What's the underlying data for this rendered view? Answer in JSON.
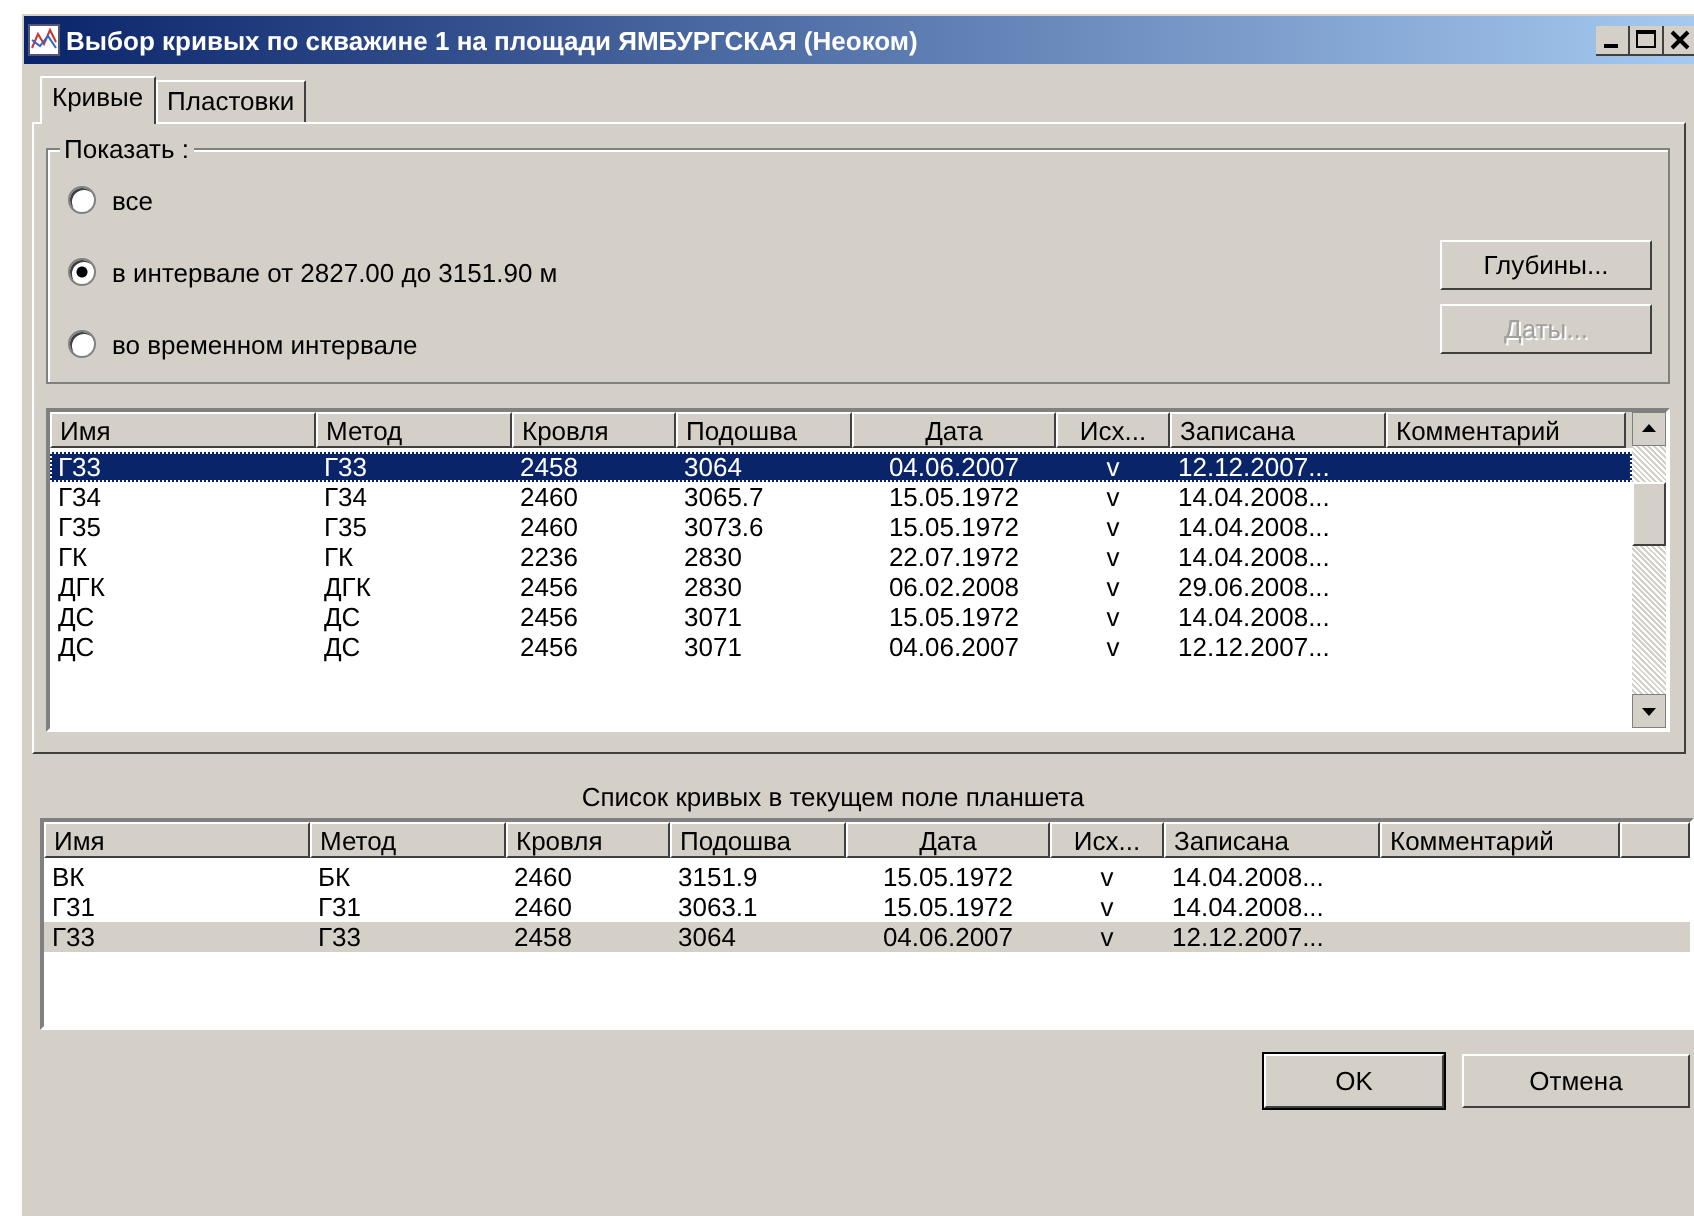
{
  "window": {
    "title": "Выбор кривых по скважине 1 на площади ЯМБУРГСКАЯ (Неоком)"
  },
  "tabs": [
    {
      "label": "Кривые",
      "selected": true
    },
    {
      "label": "Пластовки",
      "selected": false
    }
  ],
  "show_group": {
    "title": "Показать :",
    "options": [
      {
        "label": "все",
        "selected": false
      },
      {
        "label": "в интервале от 2827.00 до 3151.90 м",
        "selected": true
      },
      {
        "label": "во временном интервале",
        "selected": false
      }
    ],
    "buttons": [
      {
        "label": "Глубины...",
        "disabled": false
      },
      {
        "label": "Даты...",
        "disabled": true
      }
    ]
  },
  "curves_table": {
    "columns": [
      "Имя",
      "Метод",
      "Кровля",
      "Подошва",
      "Дата",
      "Исх...",
      "Записана",
      "Комментарий"
    ],
    "rows": [
      {
        "cells": [
          "Г33",
          "Г33",
          "2458",
          "3064",
          "04.06.2007",
          "v",
          "12.12.2007..."
        ],
        "selected": true
      },
      {
        "cells": [
          "Г34",
          "Г34",
          "2460",
          "3065.7",
          "15.05.1972",
          "v",
          "14.04.2008..."
        ],
        "selected": false
      },
      {
        "cells": [
          "Г35",
          "Г35",
          "2460",
          "3073.6",
          "15.05.1972",
          "v",
          "14.04.2008..."
        ],
        "selected": false
      },
      {
        "cells": [
          "ГК",
          "ГК",
          "2236",
          "2830",
          "22.07.1972",
          "v",
          "14.04.2008..."
        ],
        "selected": false
      },
      {
        "cells": [
          "ДГК",
          "ДГК",
          "2456",
          "2830",
          "06.02.2008",
          "v",
          "29.06.2008..."
        ],
        "selected": false
      },
      {
        "cells": [
          "ДС",
          "ДС",
          "2456",
          "3071",
          "15.05.1972",
          "v",
          "14.04.2008..."
        ],
        "selected": false
      },
      {
        "cells": [
          "ДС",
          "ДС",
          "2456",
          "3071",
          "04.06.2007",
          "v",
          "12.12.2007..."
        ],
        "selected": false
      }
    ]
  },
  "tablet_list": {
    "title": "Список кривых в текущем поле планшета",
    "columns": [
      "Имя",
      "Метод",
      "Кровля",
      "Подошва",
      "Дата",
      "Исх...",
      "Записана",
      "Комментарий"
    ],
    "rows": [
      {
        "cells": [
          "ВК",
          "БК",
          "2460",
          "3151.9",
          "15.05.1972",
          "v",
          "14.04.2008..."
        ],
        "selected": false
      },
      {
        "cells": [
          "Г31",
          "Г31",
          "2460",
          "3063.1",
          "15.05.1972",
          "v",
          "14.04.2008..."
        ],
        "selected": false
      },
      {
        "cells": [
          "Г33",
          "Г33",
          "2458",
          "3064",
          "04.06.2007",
          "v",
          "12.12.2007..."
        ],
        "selected": true
      }
    ]
  },
  "dialog_buttons": [
    {
      "label": "OK",
      "default": true
    },
    {
      "label": "Отмена",
      "default": false
    }
  ]
}
